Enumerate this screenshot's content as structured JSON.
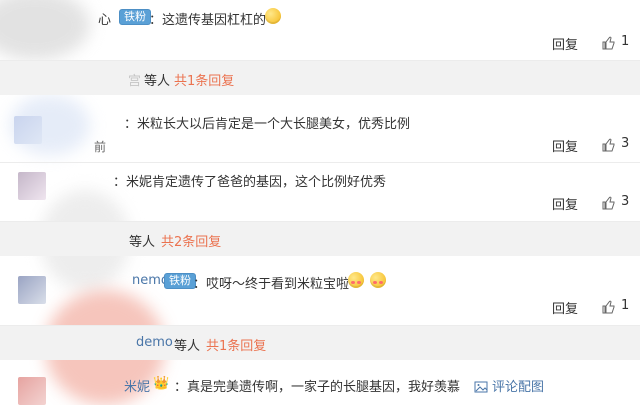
{
  "comments": [
    {
      "username": "心",
      "badge": "铁粉",
      "text": "：这遗传基因杠杠的",
      "reply_label": "回复",
      "likes": "1"
    },
    {
      "reply_summary": {
        "users_suffix": "等人",
        "count_text": "共1条回复"
      }
    },
    {
      "text": "：米粒长大以后肯定是一个大长腿美女，优秀比例",
      "time": "前",
      "reply_label": "回复",
      "likes": "3"
    },
    {
      "text": "：米妮肯定遗传了爸爸的基因，这个比例好优秀",
      "reply_label": "回复",
      "likes": "3"
    },
    {
      "reply_summary": {
        "users_suffix": "等人",
        "count_text": "共2条回复"
      }
    },
    {
      "username": "nemo",
      "badge": "铁粉",
      "text": "：哎呀～终于看到米粒宝啦",
      "reply_label": "回复",
      "likes": "1"
    },
    {
      "reply_summary": {
        "username": "demo",
        "users_suffix": "等人",
        "count_text": "共1条回复"
      }
    },
    {
      "username": "米妮",
      "text": "：真是完美遗传啊，一家子的长腿基因，我好羡慕",
      "action_label": "评论配图"
    }
  ],
  "icons": {
    "like": "thumbs-up-icon",
    "image": "image-icon",
    "badge": "fan-badge-icon"
  },
  "colors": {
    "link": "#4a76a8",
    "accent": "#eb7350",
    "badge": "#5aa0d6",
    "reply_bar": "#f2f2f2"
  }
}
